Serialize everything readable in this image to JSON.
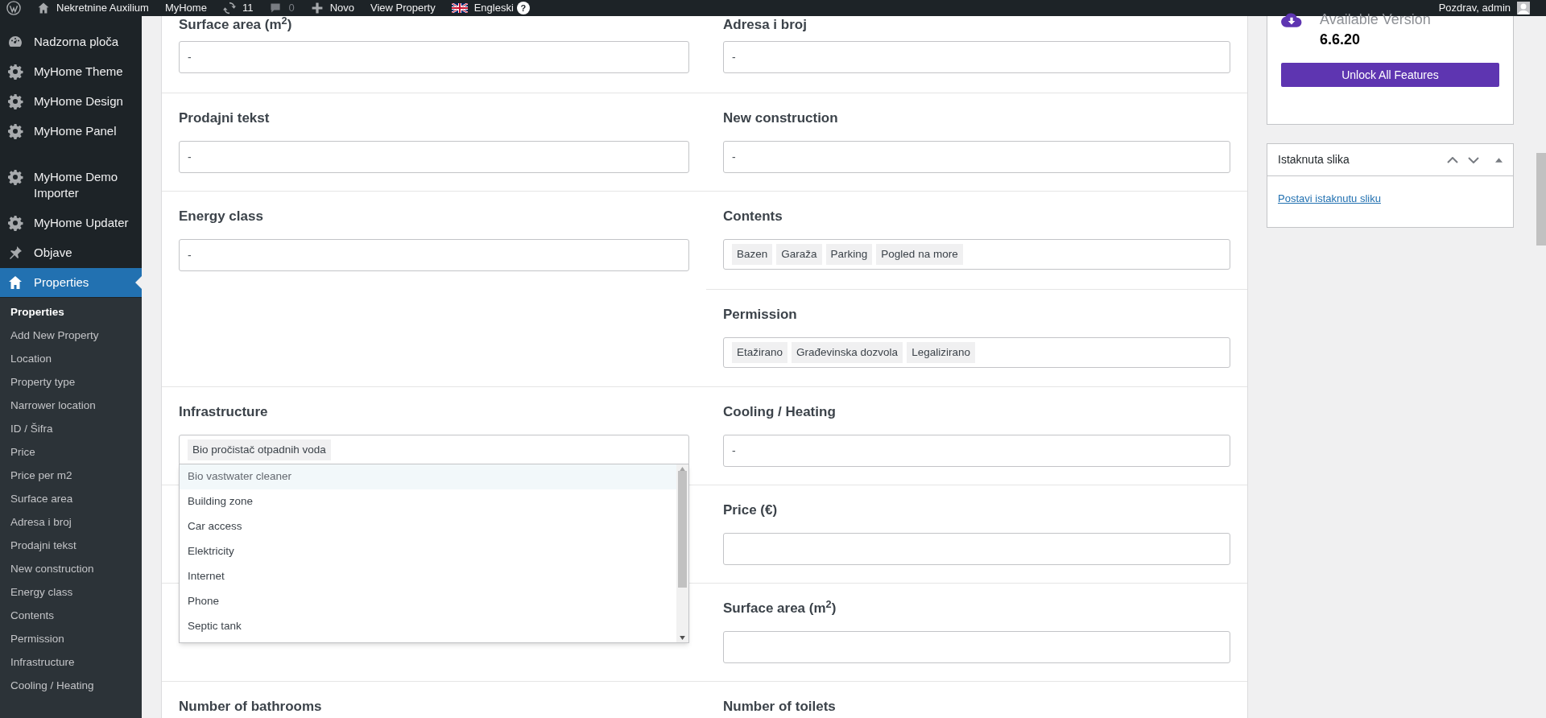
{
  "admin_bar": {
    "site": "Nekretnine Auxilium",
    "theme": "MyHome",
    "updates": "11",
    "comments": "0",
    "new": "Novo",
    "view": "View Property",
    "language": "Engleski",
    "help": "?",
    "greeting": "Pozdrav, admin"
  },
  "sidebar": {
    "items": [
      {
        "label": "Nadzorna ploča",
        "kind": "dashboard",
        "selected": false
      },
      {
        "label": "MyHome Theme",
        "kind": "plugin",
        "selected": false
      },
      {
        "label": "MyHome Design",
        "kind": "plugin",
        "selected": false
      },
      {
        "label": "MyHome Panel",
        "kind": "plugin",
        "selected": false
      },
      {
        "label": "MyHome Demo Importer",
        "kind": "plugin",
        "selected": false
      },
      {
        "label": "MyHome Updater",
        "kind": "plugin",
        "selected": false
      },
      {
        "label": "Objave",
        "kind": "posts",
        "selected": false
      },
      {
        "label": "Properties",
        "kind": "properties",
        "selected": true
      }
    ],
    "submenu": [
      {
        "label": "Properties",
        "selected": true
      },
      {
        "label": "Add New Property",
        "selected": false
      },
      {
        "label": "Location",
        "selected": false
      },
      {
        "label": "Property type",
        "selected": false
      },
      {
        "label": "Narrower location",
        "selected": false
      },
      {
        "label": "ID / Šifra",
        "selected": false
      },
      {
        "label": "Price",
        "selected": false
      },
      {
        "label": "Price per m2",
        "selected": false
      },
      {
        "label": "Surface area",
        "selected": false
      },
      {
        "label": "Adresa i broj",
        "selected": false
      },
      {
        "label": "Prodajni tekst",
        "selected": false
      },
      {
        "label": "New construction",
        "selected": false
      },
      {
        "label": "Energy class",
        "selected": false
      },
      {
        "label": "Contents",
        "selected": false
      },
      {
        "label": "Permission",
        "selected": false
      },
      {
        "label": "Infrastructure",
        "selected": false
      },
      {
        "label": "Cooling / Heating",
        "selected": false
      }
    ]
  },
  "form": {
    "rows": [
      {
        "left": [
          {
            "label": "Surface area (m$^{2}$)",
            "kind": "text",
            "value": "-"
          }
        ],
        "right": [
          {
            "label": "Adresa i broj",
            "kind": "text",
            "value": "-"
          }
        ]
      },
      {
        "left": [
          {
            "label": "Prodajni tekst",
            "kind": "text",
            "value": "-"
          }
        ],
        "right": [
          {
            "label": "New construction",
            "kind": "text",
            "value": "-"
          }
        ]
      },
      {
        "left": [
          {
            "label": "Energy class",
            "kind": "text",
            "value": "-"
          }
        ],
        "right": [
          {
            "label": "Contents",
            "kind": "tags",
            "tags": [
              "Bazen",
              "Garaža",
              "Parking",
              "Pogled na more"
            ]
          },
          {
            "label": "Permission",
            "kind": "tags",
            "tags": [
              "Etažirano",
              "Građevinska dozvola",
              "Legalizirano"
            ]
          }
        ]
      },
      {
        "left": [
          {
            "label": "Infrastructure",
            "kind": "select",
            "tags": [
              "Bio pročistač otpadnih voda"
            ],
            "expanded": true,
            "options": [
              {
                "label": "Bio vastwater cleaner",
                "selected": true
              },
              {
                "label": "Building zone",
                "selected": false
              },
              {
                "label": "Car access",
                "selected": false
              },
              {
                "label": "Elektricity",
                "selected": false
              },
              {
                "label": "Internet",
                "selected": false
              },
              {
                "label": "Phone",
                "selected": false
              },
              {
                "label": "Septic tank",
                "selected": false
              }
            ]
          }
        ],
        "right": [
          {
            "label": "Cooling / Heating",
            "kind": "text",
            "value": "-"
          }
        ]
      },
      {
        "left": [
          {
            "kind": "hidden"
          }
        ],
        "right": [
          {
            "label": "Price (€)",
            "kind": "text"
          }
        ]
      },
      {
        "left": [
          {
            "kind": "hidden"
          }
        ],
        "right": [
          {
            "label": "Surface area (m$^{2}$)",
            "kind": "text"
          }
        ]
      },
      {
        "left": [
          {
            "label": "Number of bathrooms",
            "kind": "none"
          }
        ],
        "right": [
          {
            "label": "Number of toilets",
            "kind": "none"
          }
        ]
      }
    ]
  },
  "version_box": {
    "title": "Available Version",
    "version": "6.6.20",
    "button": "Unlock All Features"
  },
  "featured_image": {
    "title": "Istaknuta slika",
    "link": "Postavi istaknutu sliku"
  }
}
